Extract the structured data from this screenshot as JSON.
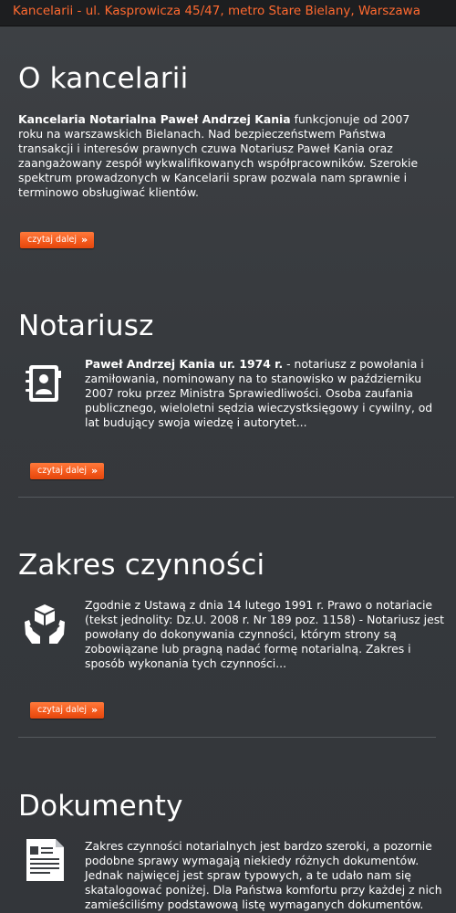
{
  "header": {
    "address": "Kancelarii - ul. Kasprowicza 45/47, metro Stare Bielany, Warszawa"
  },
  "sections": {
    "about": {
      "title": "O kancelarii",
      "lead_bold": "Kancelaria Notarialna Paweł Andrzej Kania",
      "text": " funkcjonuje od 2007 roku na warszawskich Bielanach. Nad bezpieczeństwem Państwa transakcji i interesów prawnych czuwa Notariusz Paweł Kania oraz zaangażowany zespół wykwalifikowanych współpracowników. Szerokie spektrum prowadzonych w Kancelarii spraw pozwala nam sprawnie i terminowo obsługiwać klientów.",
      "button": "czytaj dalej"
    },
    "notary": {
      "title": "Notariusz",
      "lead_bold": "Paweł Andrzej Kania ur. 1974 r.",
      "text": " - notariusz z powołania i zamiłowania, nominowany na to stanowisko w październiku 2007 roku przez Ministra Sprawiedliwości. Osoba zaufania publicznego, wieloletni sędzia wieczystksięgowy i cywilny, od lat budujący swoja wiedzę i autorytet...",
      "button": "czytaj dalej",
      "icon": "contact-book-icon"
    },
    "scope": {
      "title": "Zakres czynności",
      "text": "Zgodnie z Ustawą z dnia 14 lutego 1991 r. Prawo o notariacie (tekst jednolity: Dz.U. 2008 r. Nr 189 poz. 1158) - Notariusz jest powołany do dokonywania czynności, którym strony są zobowiązane lub pragną nadać formę notarialną. Zakres i sposób wykonania tych czynności...",
      "button": "czytaj dalej",
      "icon": "hands-box-icon"
    },
    "documents": {
      "title": "Dokumenty",
      "text": "Zakres czynności notarialnych jest bardzo szeroki, a pozornie podobne sprawy wymagają niekiedy różnych dokumentów. Jednak najwięcej jest spraw typowych, a te udało nam się skatalogować poniżej. Dla Państwa komfortu przy każdej z nich zamieściliśmy podstawową listę wymaganych dokumentów.",
      "icon": "document-icon"
    }
  },
  "colors": {
    "accent": "#f3571a",
    "header_text": "#ff6a30",
    "background": "#36393d"
  }
}
